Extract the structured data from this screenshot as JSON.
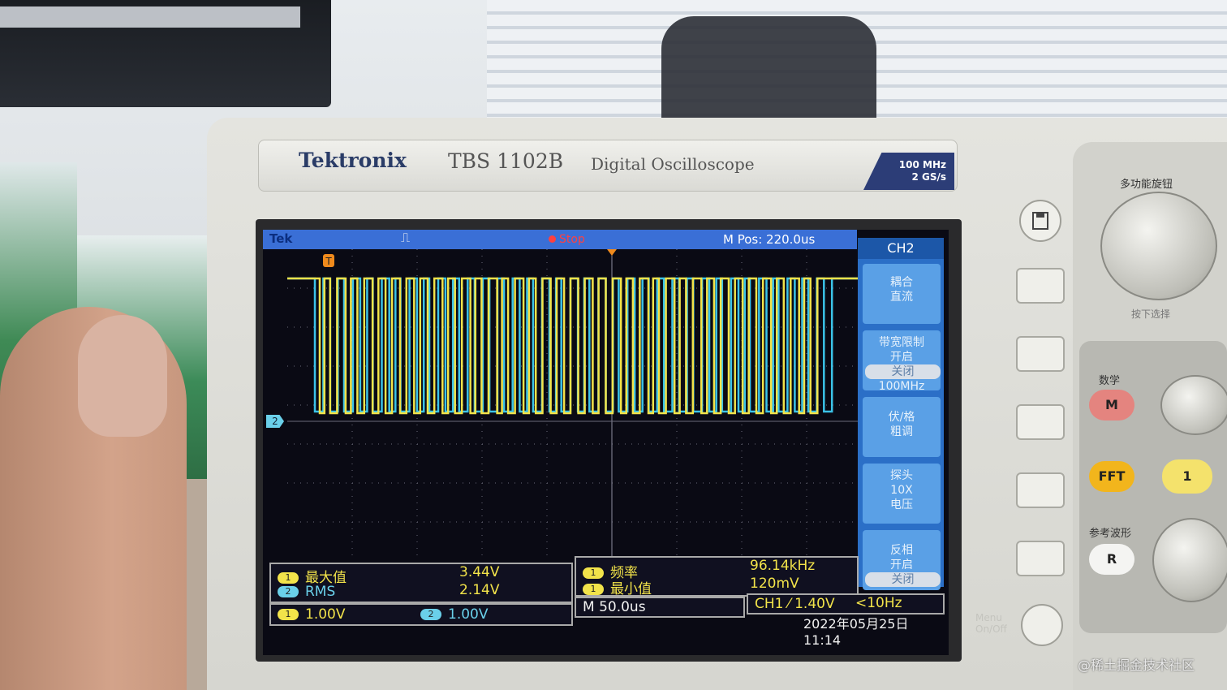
{
  "scope": {
    "brand": "Tektronix",
    "model": "TBS 1102B",
    "description": "Digital Oscilloscope",
    "spec_bandwidth": "100 MHz",
    "spec_samplerate": "2 GS/s"
  },
  "screen": {
    "topbar": {
      "logo": "Tek",
      "trigger_symbol": "⎍",
      "status": "Stop",
      "mpos": "M Pos: 220.0us"
    },
    "trigger_marker": "T",
    "ch2_marker": "2",
    "menu": {
      "title": "CH2",
      "items": [
        {
          "lines": [
            "耦合",
            "直流"
          ]
        },
        {
          "lines": [
            "带宽限制",
            "开启",
            "关闭",
            "100MHz"
          ]
        },
        {
          "lines": [
            "伏/格",
            "粗调"
          ]
        },
        {
          "lines": [
            "探头",
            "10X",
            "电压"
          ]
        },
        {
          "lines": [
            "反相",
            "开启",
            "关闭"
          ]
        }
      ]
    },
    "measurements": {
      "left": [
        {
          "badge": "1",
          "label": "最大值",
          "value": "3.44V"
        },
        {
          "badge": "2",
          "label": "RMS",
          "value": "2.14V"
        }
      ],
      "right": [
        {
          "badge": "1",
          "label": "频率",
          "value": "96.14kHz"
        },
        {
          "badge": "1",
          "label": "最小值",
          "value": "120mV"
        }
      ]
    },
    "status": {
      "ch1_badge": "1",
      "ch1_scale": "1.00V",
      "ch2_badge": "2",
      "ch2_scale": "1.00V",
      "timebase": "M 50.0us",
      "trigger": "CH1 ⁄ 1.40V",
      "freq": "<10Hz",
      "datetime": "2022年05月25日 11:14"
    }
  },
  "controls": {
    "multipurpose_label": "多功能旋钮",
    "press_select": "按下选择",
    "math_label": "数学",
    "math_button": "M",
    "fft_button": "FFT",
    "ch1_button": "1",
    "ref_label": "参考波形",
    "ref_button": "R",
    "menu_onoff_1": "Menu",
    "menu_onoff_2": "On/Off"
  },
  "watermark": "@稀土掘金技术社区",
  "colors": {
    "ch1_trace": "#f2e34a",
    "ch2_trace": "#3bc3e8",
    "topbar": "#3a6fd6",
    "menu_button": "#5aa0e6",
    "stop_red": "#ff4040"
  }
}
